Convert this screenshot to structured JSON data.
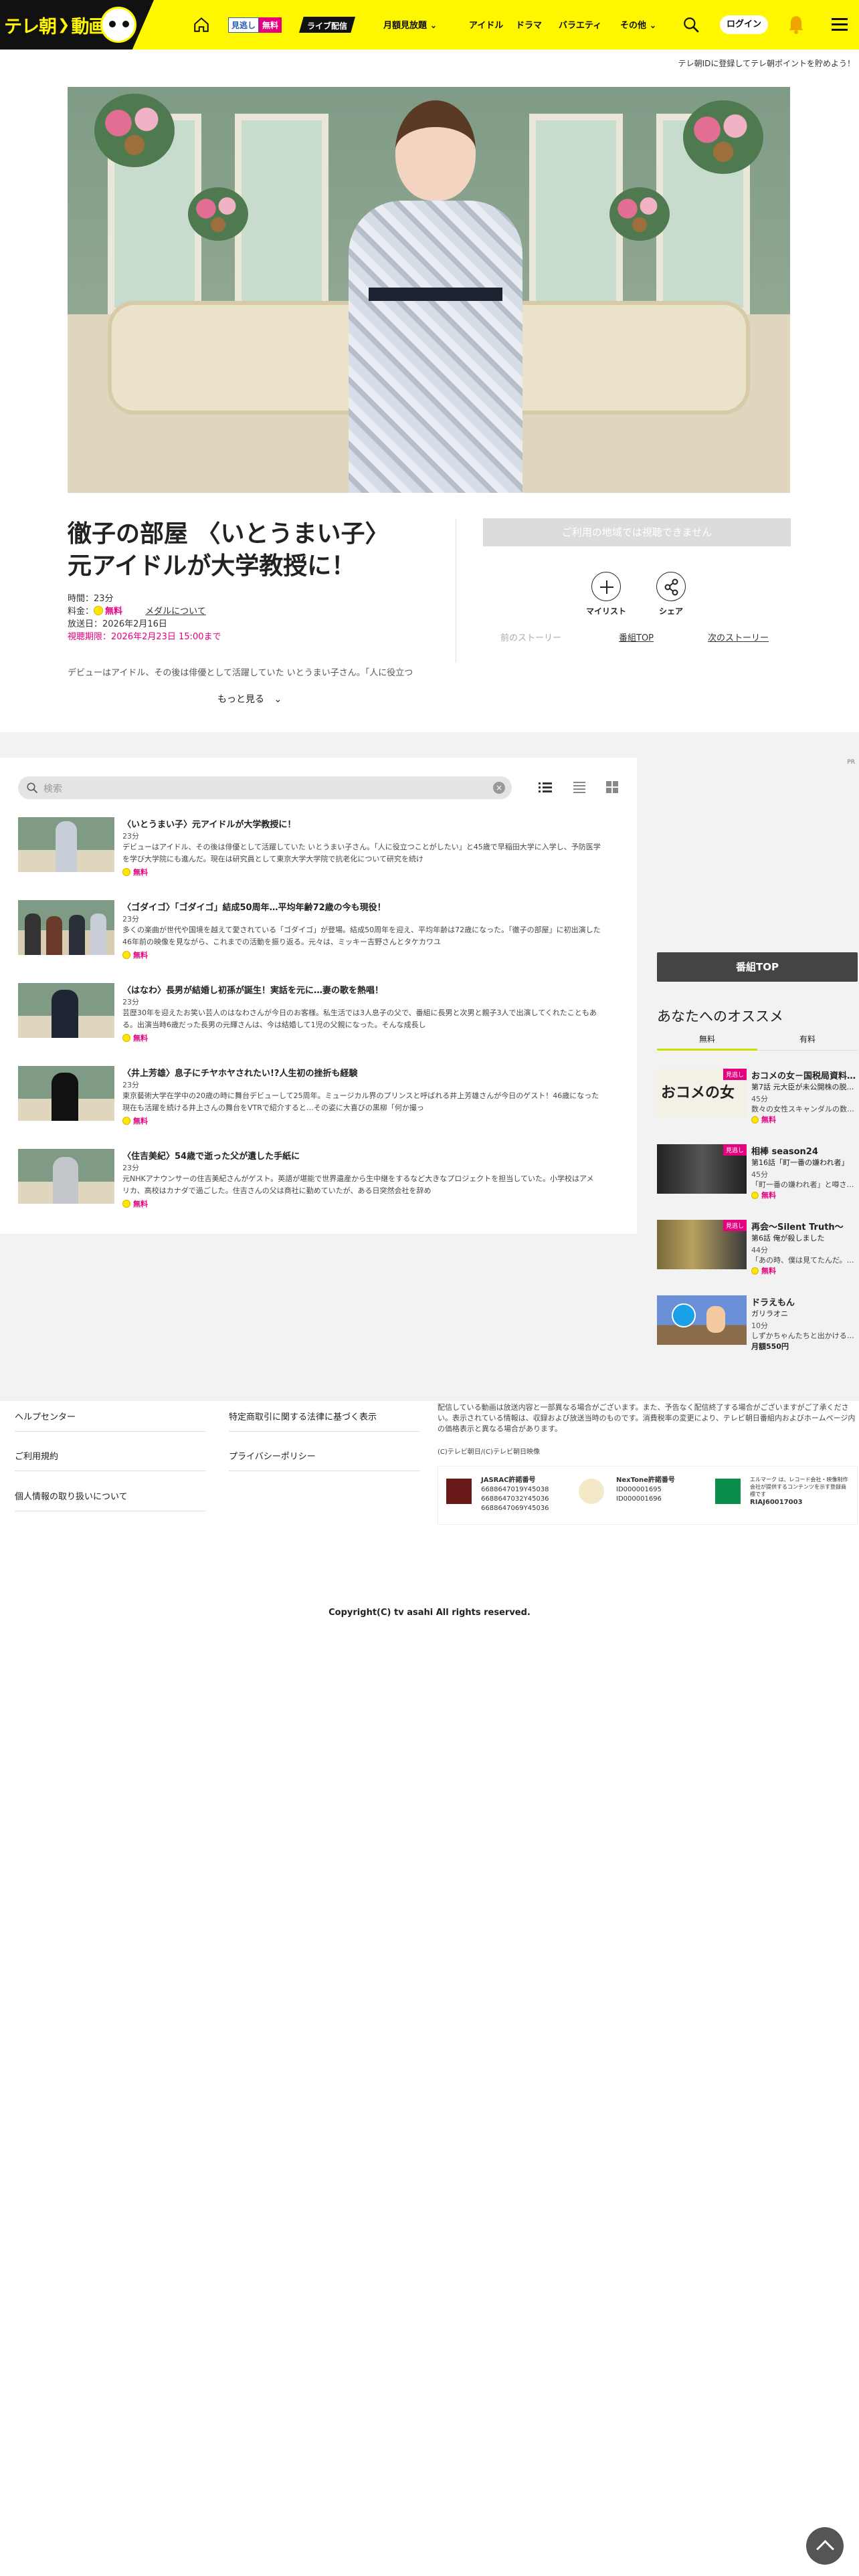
{
  "header": {
    "logo_text": "テレ朝",
    "logo_text2": "動画",
    "free_label_a": "見逃し",
    "free_label_b": "無料",
    "live_label": "ライブ配信",
    "nav": [
      "月額見放題",
      "アイドル",
      "ドラマ",
      "バラエティ",
      "その他"
    ],
    "login_label": "ログイン",
    "promo": "テレ朝IDに登録してテレ朝ポイントを貯めよう！"
  },
  "episode": {
    "title_line1": "徹子の部屋 〈いとうまい子〉",
    "title_line2": "元アイドルが大学教授に！",
    "duration_label": "時間：23分",
    "price_label": "料金：",
    "price_free": "無料",
    "medal_link": "メダルについて",
    "broadcast": "放送日：2026年2月16日",
    "period": "視聴期限：2026年2月23日 15:00まで",
    "description": "デビューはアイドル、その後は俳優として活躍していた いとうまい子さん。「人に役立つ",
    "more_label": "もっと見る"
  },
  "actions": {
    "watch_disabled": "ご利用の地域では視聴できません",
    "mylist": "マイリスト",
    "share": "シェア",
    "prev_story": "前のストーリー",
    "program_top": "番組TOP",
    "next_story": "次のストーリー"
  },
  "list": {
    "pm_label": "PR",
    "search_placeholder": "検索",
    "clear": "×",
    "free_label": "無料",
    "episodes": [
      {
        "title": "〈いとうまい子〉元アイドルが大学教授に！",
        "duration": "23分",
        "desc": "デビューはアイドル、その後は俳優として活躍していた いとうまい子さん。「人に役立つことがしたい」と45歳で早稲田大学に入学し、予防医学を学び大学院にも進んだ。現在は研究員として東京大学大学院で抗老化について研究を続け"
      },
      {
        "title": "〈ゴダイゴ〉「ゴダイゴ」結成50周年…平均年齢72歳の今も現役！",
        "duration": "23分",
        "desc": "多くの楽曲が世代や国境を越えて愛されている「ゴダイゴ」が登場。結成50周年を迎え、平均年齢は72歳になった。「徹子の部屋」に初出演した46年前の映像を見ながら、これまでの活動を振り返る。元々は、ミッキー吉野さんとタケカワユ"
      },
      {
        "title": "〈はなわ〉長男が結婚し初孫が誕生！実話を元に…妻の歌を熱唱！",
        "duration": "23分",
        "desc": "芸歴30年を迎えたお笑い芸人のはなわさんが今日のお客様。私生活では3人息子の父で、番組に長男と次男と親子3人で出演してくれたこともある。出演当時6歳だった長男の元輝さんは、今は結婚して1児の父親になった。そんな成長し"
      },
      {
        "title": "〈井上芳雄〉息子にチヤホヤされたい!?人生初の挫折も経験",
        "duration": "23分",
        "desc": "東京藝術大学在学中の20歳の時に舞台デビューして25周年。ミュージカル界のプリンスと呼ばれる井上芳雄さんが今日のゲスト！46歳になった現在も活躍を続ける井上さんの舞台をVTRで紹介すると…その姿に大喜びの黒柳「何か撮っ"
      },
      {
        "title": "〈住吉美紀〉54歳で逝った父が遺した手紙に",
        "duration": "23分",
        "desc": "元NHKアナウンサーの住吉美紀さんがゲスト。英語が堪能で世界遺産から生中継をするなど大きなプロジェクトを担当していた。小学校はアメリカ、高校はカナダで過ごした。住吉さんの父は商社に勤めていたが、ある日突然会社を辞め"
      }
    ]
  },
  "rail": {
    "program_top_button": "番組TOP",
    "heading": "あなたへのオススメ",
    "tab_free": "無料",
    "tab_paid": "有料",
    "items": [
      {
        "title": "おコメの女－国税局資料…",
        "sub": "第7話 元大臣が未公開株の脱…",
        "duration": "45分",
        "desc": "数々の女性スキャンダルの数…",
        "tag": "見逃し",
        "badge": "無料"
      },
      {
        "title": "相棒 season24",
        "sub": "第16話「町一番の嫌われ者」",
        "duration": "45分",
        "desc": "「町一番の嫌われ者」と噂さ…",
        "tag": "見逃し",
        "badge": "無料"
      },
      {
        "title": "再会～Silent Truth～",
        "sub": "第6話 俺が殺しました",
        "duration": "44分",
        "desc": "「あの時、僕は見てたんだ。…",
        "tag": "見逃し",
        "badge": "無料"
      },
      {
        "title": "ドラえもん",
        "sub": "ガリラオニ",
        "duration": "10分",
        "desc": "しずかちゃんたちと出かける…",
        "tag": "",
        "price": "月額550円"
      }
    ]
  },
  "footer": {
    "links_col1": [
      "ヘルプセンター",
      "ご利用規約",
      "個人情報の取り扱いについて"
    ],
    "links_col2": [
      "特定商取引に関する法律に基づく表示",
      "プライバシーポリシー"
    ],
    "note": "配信している動画は放送内容と一部異なる場合がございます。また、予告なく配信終了する場合がございますがご了承ください。表示されている情報は、収録および放送当時のものです。消費税率の変更により、テレビ朝日番組内およびホームページ内の価格表示と異なる場合があります。",
    "small_copyright": "(C)テレビ朝日/(C)テレビ朝日映像",
    "jasrac_title": "JASRAC許諾番号",
    "jasrac_nums": [
      "6688647019Y45038",
      "6688647032Y45036",
      "6688647069Y45036"
    ],
    "nextone_title": "NexTone許諾番号",
    "nextone_nums": [
      "ID000001695",
      "ID000001696"
    ],
    "ribm_text": "エルマーク は、レコード会社・映像制作会社が提供するコンテンツを示す登録商標です",
    "ribm_num": "RIAJ60017003",
    "copyright": "Copyright(C) tv asahi All rights reserved."
  }
}
